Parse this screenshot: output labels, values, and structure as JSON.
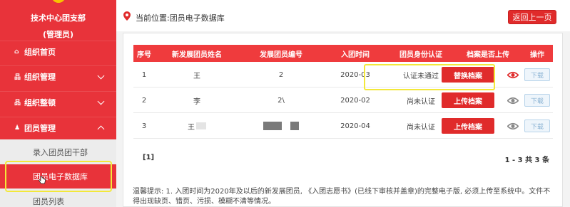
{
  "sidebar": {
    "org_name": "技术中心团支部",
    "role": "(管理员)",
    "items": [
      {
        "label": "组织首页",
        "icon": "home-icon",
        "glyph": "🏠"
      },
      {
        "label": "组织管理",
        "icon": "org-icon",
        "glyph": "品"
      },
      {
        "label": "组织整顿",
        "icon": "org-icon",
        "glyph": "品"
      },
      {
        "label": "团员管理",
        "icon": "user-group-icon",
        "glyph": "👥"
      }
    ],
    "subitems": [
      {
        "label": "录入团员团干部"
      },
      {
        "label": "团员电子数据库"
      },
      {
        "label": "团员列表"
      }
    ]
  },
  "topbar": {
    "location": "当前位置:团员电子数据库",
    "back_button": "返回上一页"
  },
  "table": {
    "headers": [
      "序号",
      "新发展团员姓名",
      "发展团员编号",
      "入团时间",
      "团员身份认证",
      "档案是否上传",
      "操作"
    ],
    "rows": [
      {
        "index": "1",
        "name": "王",
        "number": "2",
        "join_date": "2020-03",
        "status": "认证未通过",
        "upload_label": "替换档案",
        "download": "下载"
      },
      {
        "index": "2",
        "name": "李",
        "number": "2\\",
        "join_date": "2020-02",
        "status": "尚未认证",
        "upload_label": "上传档案",
        "download": "下载"
      },
      {
        "index": "3",
        "name": "王",
        "number": "",
        "join_date": "2020-04",
        "status": "尚未认证",
        "upload_label": "上传档案",
        "download": "下载"
      }
    ]
  },
  "pager": {
    "current": "[1]",
    "summary": "1 - 3 共 3 条"
  },
  "tip": "温馨提示: 1. 入团时间为2020年及以后的新发展团员, 《入团志愿书》(已线下审核并盖章)的完整电子版, 必须上传至系统中。文件不得出现缺页、错页、污损、模糊不清等情况。",
  "colors": {
    "accent": "#e8333a",
    "button": "#e02b2b",
    "highlight": "#f3e83a"
  }
}
